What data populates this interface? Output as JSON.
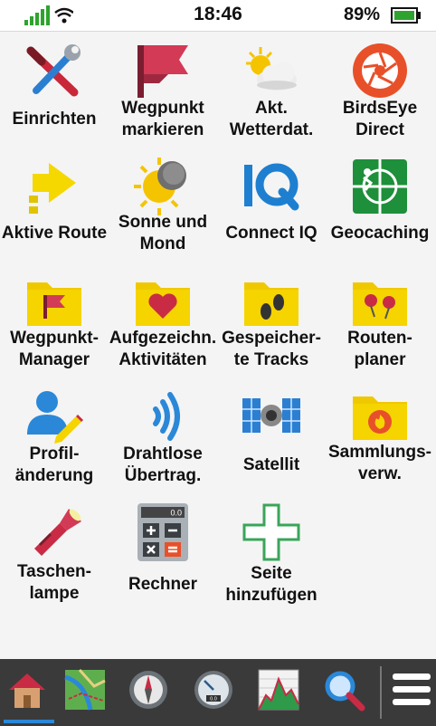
{
  "status": {
    "time": "18:46",
    "battery": "89%"
  },
  "apps": [
    {
      "label": "Einrichten",
      "icon": "tools-icon"
    },
    {
      "label": "Wegpunkt\nmarkieren",
      "icon": "flag-icon"
    },
    {
      "label": "Akt.\nWetterdat.",
      "icon": "weather-icon"
    },
    {
      "label": "BirdsEye\nDirect",
      "icon": "birdseye-icon"
    },
    {
      "label": "Aktive Route",
      "icon": "route-arrow-icon"
    },
    {
      "label": "Sonne und\nMond",
      "icon": "sun-moon-icon"
    },
    {
      "label": "Connect IQ",
      "icon": "connect-iq-icon"
    },
    {
      "label": "Geocaching",
      "icon": "geocaching-icon"
    },
    {
      "label": "Wegpunkt-\nManager",
      "icon": "waypoint-folder-icon"
    },
    {
      "label": "Aufgezeichn.\nAktivitäten",
      "icon": "heart-folder-icon"
    },
    {
      "label": "Gespeicher-\nte Tracks",
      "icon": "tracks-folder-icon"
    },
    {
      "label": "Routen-\nplaner",
      "icon": "pins-folder-icon"
    },
    {
      "label": "Profil-\nänderung",
      "icon": "profile-icon"
    },
    {
      "label": "Drahtlose\nÜbertrag.",
      "icon": "wireless-icon"
    },
    {
      "label": "Satellit",
      "icon": "satellite-icon"
    },
    {
      "label": "Sammlungs-\nverw.",
      "icon": "collection-folder-icon"
    },
    {
      "label": "Taschen-\nlampe",
      "icon": "flashlight-icon"
    },
    {
      "label": "Rechner",
      "icon": "calculator-icon"
    },
    {
      "label": "Seite\nhinzufügen",
      "icon": "add-page-icon"
    }
  ],
  "calculator_display": "0.0",
  "gauge_display": "0.0",
  "bottom_bar": [
    "home-icon",
    "map-icon",
    "compass-icon",
    "gauge-icon",
    "elevation-icon",
    "search-icon",
    "menu-icon"
  ]
}
